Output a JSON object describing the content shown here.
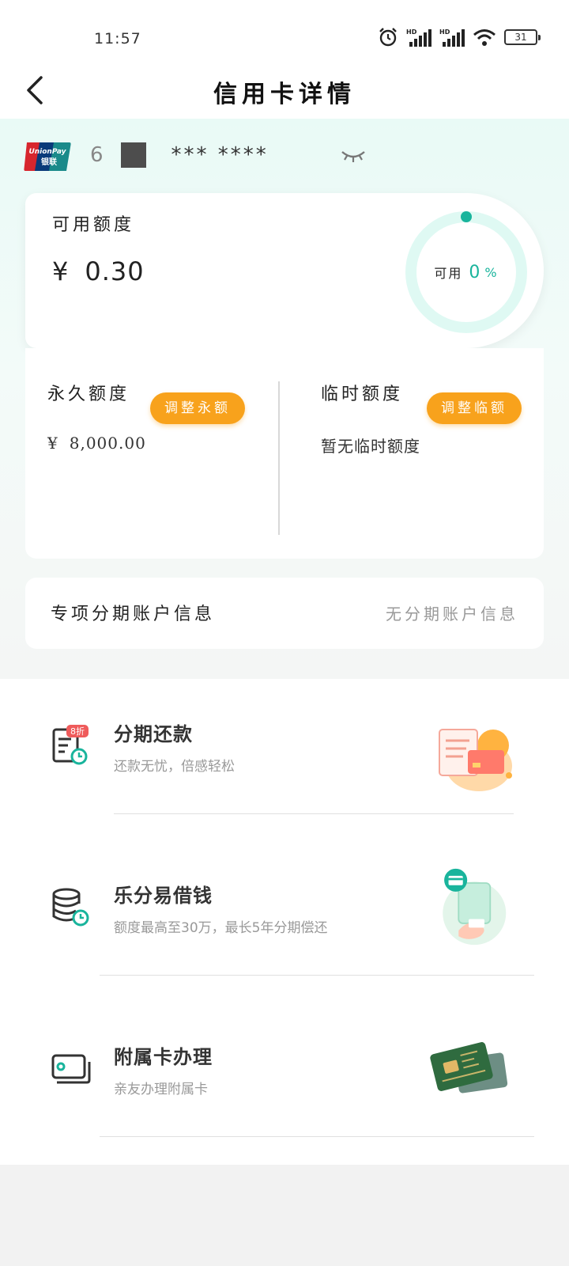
{
  "status_bar": {
    "time": "11:57",
    "battery": "31"
  },
  "nav": {
    "title": "信用卡详情"
  },
  "card": {
    "number_prefix": "6",
    "number_masked": "*** ****"
  },
  "available": {
    "label": "可用额度",
    "currency": "¥",
    "amount": "0.30",
    "ring_label": "可用",
    "ring_percent": "0",
    "ring_percent_sign": "%"
  },
  "limits": {
    "permanent": {
      "title": "永久额度",
      "currency": "¥",
      "value": "8,000.00",
      "button": "调整永额"
    },
    "temporary": {
      "title": "临时额度",
      "value": "暂无临时额度",
      "button": "调整临额"
    }
  },
  "installment_account": {
    "label": "专项分期账户信息",
    "value": "无分期账户信息"
  },
  "services": [
    {
      "title": "分期还款",
      "subtitle": "还款无忧，倍感轻松",
      "badge": "8折",
      "icon": "bill-clock-icon"
    },
    {
      "title": "乐分易借钱",
      "subtitle": "额度最高至30万，最长5年分期偿还",
      "icon": "coins-clock-icon"
    },
    {
      "title": "附属卡办理",
      "subtitle": "亲友办理附属卡",
      "icon": "card-stack-icon"
    }
  ],
  "colors": {
    "accent_green": "#19b49c",
    "button_orange": "#f8a21c",
    "ring_track": "#dff9f3"
  }
}
